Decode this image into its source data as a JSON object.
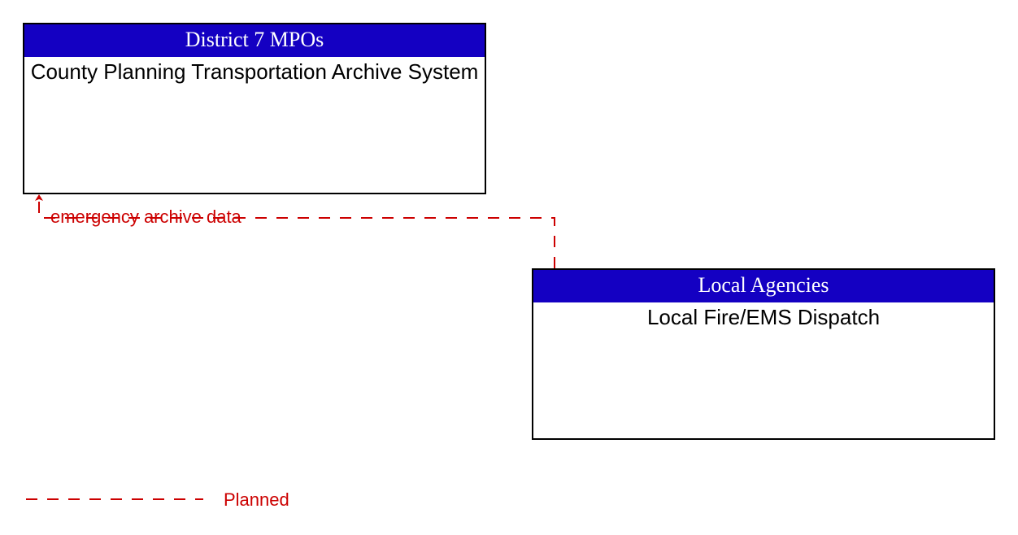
{
  "entities": {
    "top": {
      "header": "District 7 MPOs",
      "body": "County Planning Transportation Archive System"
    },
    "bottom": {
      "header": "Local Agencies",
      "body": "Local Fire/EMS Dispatch"
    }
  },
  "flow": {
    "label": "emergency archive data"
  },
  "legend": {
    "planned": "Planned"
  },
  "colors": {
    "header_bg": "#1400c2",
    "header_fg": "#ffffff",
    "flow": "#cc0000",
    "border": "#000000"
  }
}
